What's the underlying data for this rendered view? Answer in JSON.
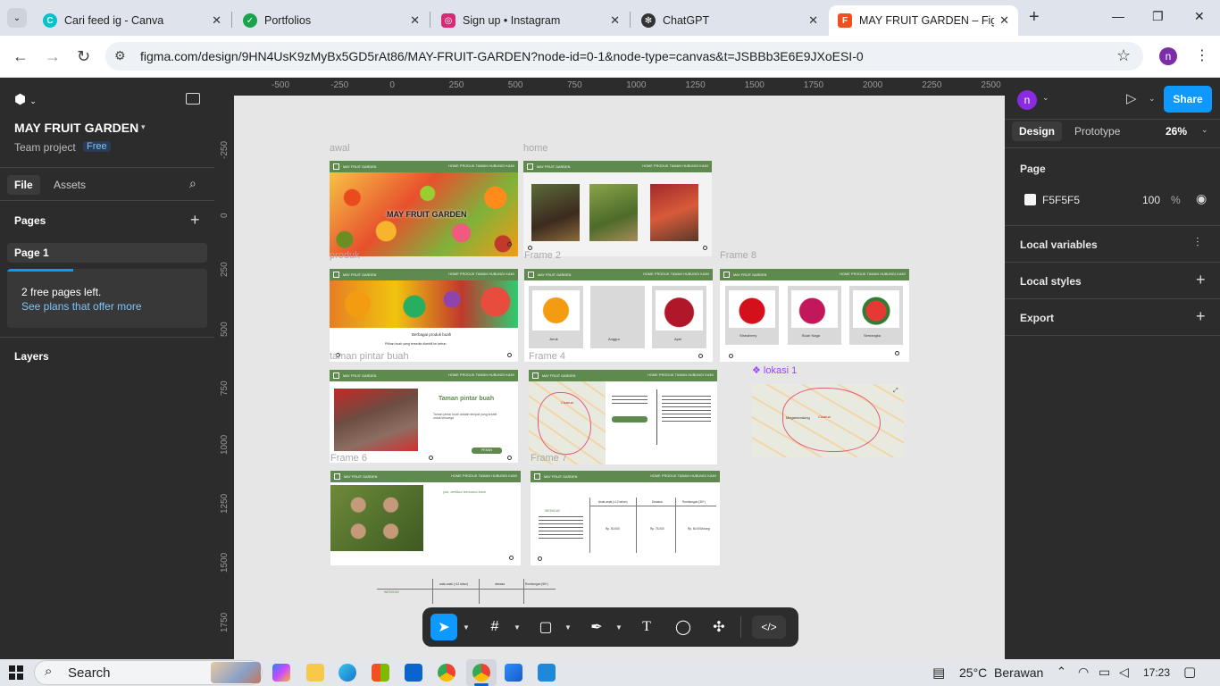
{
  "browser": {
    "tabs": [
      {
        "title": "Cari feed ig - Canva",
        "icon": "canva-icon",
        "color": "#7d2ae8"
      },
      {
        "title": "Portfolios",
        "icon": "check-circle-icon",
        "color": "#1aa34a"
      },
      {
        "title": "Sign up • Instagram",
        "icon": "instagram-icon",
        "color": "#d62976"
      },
      {
        "title": "ChatGPT",
        "icon": "chatgpt-icon",
        "color": "#333333"
      },
      {
        "title": "MAY FRUIT GARDEN – Figma",
        "icon": "figma-icon",
        "color": "#f24e1e"
      }
    ],
    "url": "figma.com/design/9HN4UsK9zMyBx5GD5rAt86/MAY-FRUIT-GARDEN?node-id=0-1&node-type=canvas&t=JSBBb3E6E9JXoESI-0",
    "profile_initial": "n"
  },
  "figma": {
    "file_name": "MAY FRUIT GARDEN",
    "team": "Team project",
    "plan_badge": "Free",
    "tab_file": "File",
    "tab_assets": "Assets",
    "pages_header": "Pages",
    "page_1": "Page 1",
    "free_pages_note": "2 free pages left.",
    "see_plans": "See plans that offer more",
    "layers_header": "Layers",
    "right": {
      "user_initial": "n",
      "share": "Share",
      "tab_design": "Design",
      "tab_prototype": "Prototype",
      "zoom": "26%",
      "page_header": "Page",
      "page_color": "F5F5F5",
      "page_opacity": "100",
      "percent": "%",
      "local_variables": "Local variables",
      "local_styles": "Local styles",
      "export": "Export"
    },
    "ruler_x": [
      "-500",
      "-250",
      "0",
      "250",
      "500",
      "750",
      "1000",
      "1250",
      "1500",
      "1750",
      "2000",
      "2250",
      "2500"
    ],
    "ruler_y": [
      "-250",
      "0",
      "250",
      "500",
      "750",
      "1000",
      "1250",
      "1500",
      "1750"
    ]
  },
  "canvas": {
    "frame_labels": {
      "awal": "awal",
      "home": "home",
      "produk": "produk",
      "frame2": "Frame 2",
      "frame8": "Frame 8",
      "taman": "taman pintar buah",
      "frame4": "Frame 4",
      "lokasi": "lokasi 1",
      "frame6": "Frame 6",
      "frame7": "Frame 7"
    },
    "site": {
      "brand": "MAY FRUIT GARDEN",
      "nav": "HOME   PRODUK   TAMAN   HUBUNGI KAMI",
      "hero_title": "MAY FRUIT GARDEN",
      "produk_caption": "Berbagai produk buah",
      "produk_sub": "Pilihan buah yang tersedia diambil ke kebun",
      "fruits_row1": [
        "Jeruk",
        "Anggur",
        "Apel"
      ],
      "fruits_row2": [
        "Strawberry",
        "Buah Naga",
        "Semangka"
      ],
      "taman_title": "Taman pintar buah",
      "taman_text": "Taman pintar buah adalah tempat yang kreatif untuk keluarga",
      "taman_button": "PESAN",
      "frame6_text": "yuk, berlibur bersama kami",
      "weekday": "WEEKDAY",
      "weekday2": "WEEKDAY",
      "table_cols": [
        "Anak-anak (<12 tahun)",
        "Dewasa",
        "Rombongan (30+)"
      ],
      "table_cols2": [
        "anak-anak (<12 tahun)",
        "dewasa",
        "Rombongan (50+)"
      ],
      "prices": [
        "Rp. 50.000",
        "Rp. 75.000",
        "Rp. 60.000/orang"
      ],
      "map_city": "Cisarua",
      "map_city2": "Megamendung"
    }
  },
  "toolbar": {
    "tools": [
      "move-tool-icon",
      "frame-tool-icon",
      "shape-tool-icon",
      "pen-tool-icon",
      "text-tool-icon",
      "comment-tool-icon",
      "actions-tool-icon",
      "dev-mode-icon"
    ]
  },
  "help": "?",
  "taskbar": {
    "search": "Search",
    "weather": "25°C  Berawan",
    "time": "17:23"
  }
}
